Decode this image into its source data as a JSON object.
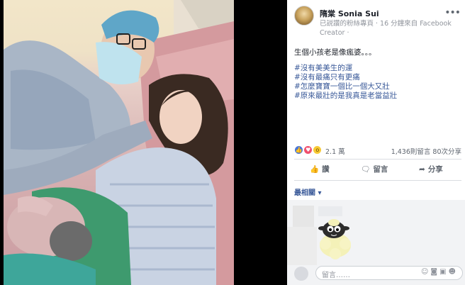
{
  "post": {
    "author": "隋棠 Sonia Sui",
    "meta": "已説讚的粉絲專頁 · 16 分鐘來自 Facebook Creator ·",
    "text": "生個小孩老是像瘋婆。。。",
    "hashtags": [
      "#沒有美美生的運",
      "#沒有最痛只有更痛",
      "#怎麼寶寶一個比一個大又壯",
      "#原來最壯的是我真是老當益壯"
    ]
  },
  "reactions": {
    "count": "2.1 萬",
    "stats": "1,436則留言 80次分享"
  },
  "actions": {
    "like": "讚",
    "comment": "留言",
    "share": "分享"
  },
  "comments": {
    "sort": "最相關 ▾",
    "placeholder": "留言……"
  },
  "colors": {
    "link": "#385898",
    "secondary": "#90949c",
    "like_blue": "#4a77d8",
    "love_red": "#f0506e",
    "wow_yellow": "#f7c934"
  },
  "icons": {
    "more": "ellipsis-icon",
    "like": "thumbs-up-icon",
    "comment": "speech-bubble-icon",
    "share": "share-arrow-icon",
    "emoji": "emoji-icon",
    "camera": "camera-icon",
    "gif": "gif-icon",
    "sticker": "sticker-icon"
  }
}
